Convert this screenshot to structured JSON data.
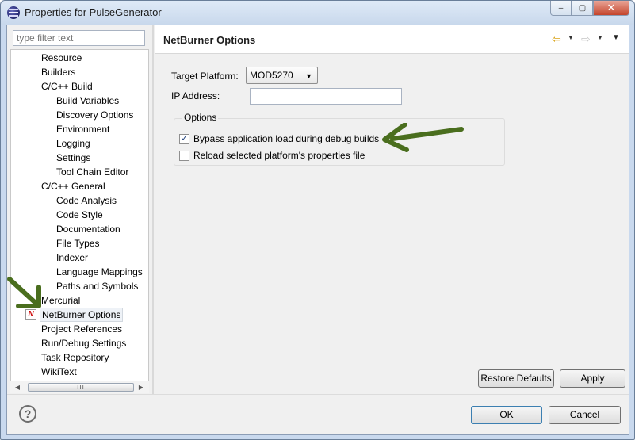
{
  "window": {
    "title": "Properties for PulseGenerator",
    "minimize_glyph": "‒",
    "maximize_glyph": "▢",
    "close_glyph": "✕"
  },
  "filter": {
    "placeholder": "type filter text"
  },
  "tree": {
    "items": [
      {
        "label": "Resource",
        "level": 1
      },
      {
        "label": "Builders",
        "level": 1
      },
      {
        "label": "C/C++ Build",
        "level": 1
      },
      {
        "label": "Build Variables",
        "level": 2
      },
      {
        "label": "Discovery Options",
        "level": 2
      },
      {
        "label": "Environment",
        "level": 2
      },
      {
        "label": "Logging",
        "level": 2
      },
      {
        "label": "Settings",
        "level": 2
      },
      {
        "label": "Tool Chain Editor",
        "level": 2
      },
      {
        "label": "C/C++ General",
        "level": 1
      },
      {
        "label": "Code Analysis",
        "level": 2
      },
      {
        "label": "Code Style",
        "level": 2
      },
      {
        "label": "Documentation",
        "level": 2
      },
      {
        "label": "File Types",
        "level": 2
      },
      {
        "label": "Indexer",
        "level": 2
      },
      {
        "label": "Language Mappings",
        "level": 2
      },
      {
        "label": "Paths and Symbols",
        "level": 2
      },
      {
        "label": "Mercurial",
        "level": 1
      },
      {
        "label": "NetBurner Options",
        "level": 1,
        "selected": true
      },
      {
        "label": "Project References",
        "level": 1
      },
      {
        "label": "Run/Debug Settings",
        "level": 1
      },
      {
        "label": "Task Repository",
        "level": 1
      },
      {
        "label": "WikiText",
        "level": 1
      }
    ],
    "selected_icon_glyph": "N",
    "scroll_left": "◀",
    "scroll_right": "▶",
    "scroll_grip": "III"
  },
  "page": {
    "title": "NetBurner Options",
    "nav": {
      "back": "⇦",
      "forward": "⇨",
      "dropdown": "▼",
      "menu": "▼"
    },
    "target_platform": {
      "label": "Target Platform:",
      "value": "MOD5270",
      "caret": "▼"
    },
    "ip_address": {
      "label": "IP Address:",
      "value": ""
    },
    "options": {
      "label": "Options",
      "bypass": {
        "label": "Bypass application load during debug builds",
        "checked": true,
        "check_glyph": "✓"
      },
      "reload": {
        "label": "Reload selected platform's properties file",
        "checked": false
      }
    },
    "restore_defaults": "Restore Defaults",
    "apply": "Apply"
  },
  "footer": {
    "help_glyph": "?",
    "ok": "OK",
    "cancel": "Cancel"
  },
  "colors": {
    "annotation_arrow": "#4a6e1e",
    "selection_border": "#d2d8df"
  }
}
